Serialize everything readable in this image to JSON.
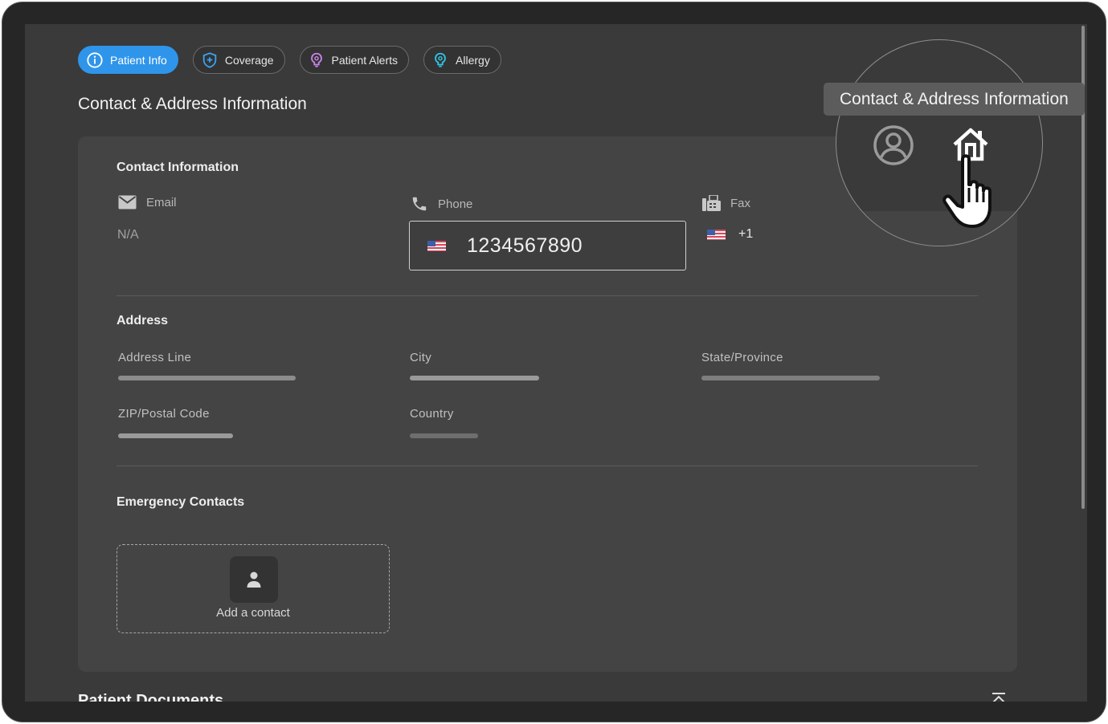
{
  "tabs": [
    {
      "label": "Patient Info",
      "icon": "info-icon",
      "active": true
    },
    {
      "label": "Coverage",
      "icon": "shield-icon",
      "active": false
    },
    {
      "label": "Patient Alerts",
      "icon": "alert-icon",
      "active": false
    },
    {
      "label": "Allergy",
      "icon": "allergy-icon",
      "active": false
    }
  ],
  "page": {
    "section_title": "Contact & Address Information",
    "next_section_title": "Patient Documents"
  },
  "contact": {
    "heading": "Contact Information",
    "email_label": "Email",
    "email_value": "N/A",
    "phone_label": "Phone",
    "phone_value": "1234567890",
    "fax_label": "Fax",
    "fax_value": "+1"
  },
  "address": {
    "heading": "Address",
    "address_line_label": "Address Line",
    "city_label": "City",
    "state_label": "State/Province",
    "zip_label": "ZIP/Postal Code",
    "country_label": "Country"
  },
  "emergency": {
    "heading": "Emergency Contacts",
    "add_label": "Add a contact"
  },
  "tooltip": {
    "text": "Contact & Address Information"
  },
  "colors": {
    "accent": "#2f95ea",
    "background": "#3a3a3a",
    "card": "#444444"
  }
}
